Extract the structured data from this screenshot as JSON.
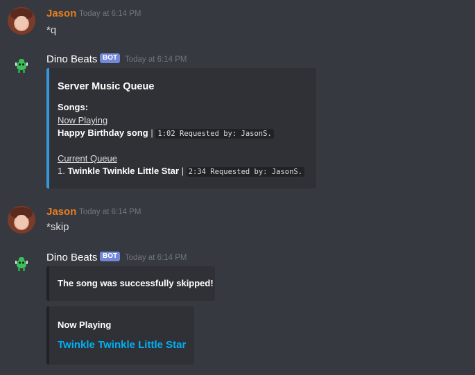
{
  "messages": [
    {
      "author": "Jason",
      "timestamp": "Today at 6:14 PM",
      "text": "*q"
    },
    {
      "author": "Dino Beats",
      "bot_tag": "BOT",
      "timestamp": "Today at 6:14 PM",
      "embed": {
        "title": "Server Music Queue",
        "songs_label": "Songs:",
        "now_playing_label": "Now Playing",
        "now_playing_song": "Happy Birthday song",
        "separator": "|",
        "now_playing_info": "1:02 Requested by: JasonS.",
        "current_queue_label": "Current Queue",
        "queue_item_index": "1.",
        "queue_item_song": "Twinkle Twinkle Little Star",
        "queue_item_info": "2:34 Requested by: JasonS."
      }
    },
    {
      "author": "Jason",
      "timestamp": "Today at 6:14 PM",
      "text": "*skip"
    },
    {
      "author": "Dino Beats",
      "bot_tag": "BOT",
      "timestamp": "Today at 6:14 PM",
      "embed_skip": {
        "text": "The song was successfully skipped!"
      },
      "embed_now": {
        "title": "Now Playing",
        "song_link": "Twinkle Twinkle Little Star"
      }
    }
  ],
  "colors": {
    "background": "#36393f",
    "embed_bg": "#2f3136",
    "embed_border_queue": "#3498db",
    "embed_border_default": "#202225",
    "jason": "#e67e22",
    "bot_tag": "#7289da",
    "link": "#00b0f4"
  },
  "icons": {
    "user_avatar": "user-avatar",
    "bot_avatar": "dino-avatar-icon"
  }
}
